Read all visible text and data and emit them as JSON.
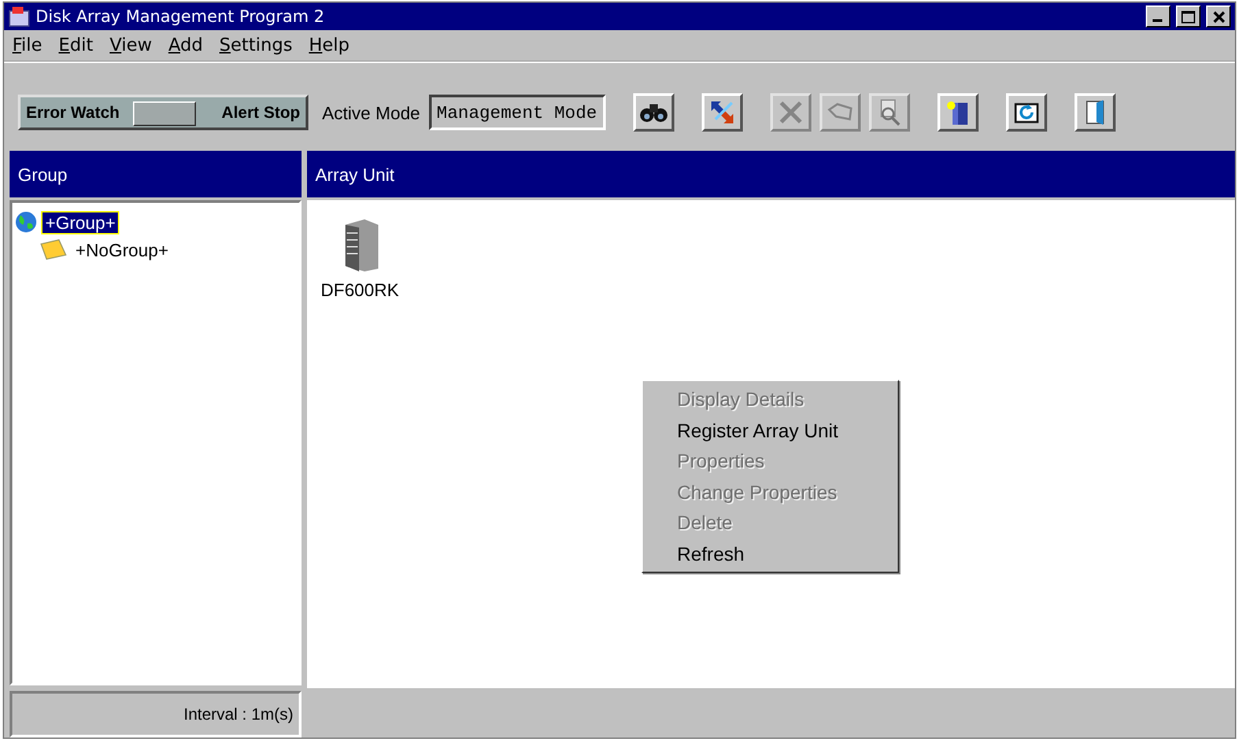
{
  "window": {
    "title": "Disk Array Management Program 2"
  },
  "menu": [
    "File",
    "Edit",
    "View",
    "Add",
    "Settings",
    "Help"
  ],
  "toolbar": {
    "switch_labels": [
      "Error Watch",
      "Alert Stop"
    ],
    "switch": {
      "level": 0.5
    },
    "mode_label": "Active Mode",
    "mode_value": "Management Mode",
    "buttons": [
      {
        "kind": "binoculars",
        "disabled": false
      },
      {
        "kind": "arrows",
        "disabled": false
      },
      {
        "kind": "cross",
        "disabled": true
      },
      {
        "kind": "tag",
        "disabled": true
      },
      {
        "kind": "magnifier",
        "disabled": true
      },
      {
        "kind": "server",
        "disabled": false
      },
      {
        "kind": "refresh",
        "disabled": false
      },
      {
        "kind": "exit",
        "disabled": false
      }
    ]
  },
  "group_panel": {
    "title": "Group",
    "tree": [
      {
        "label": "+Group+",
        "selected": true,
        "children": [
          {
            "label": "+NoGroup+",
            "selected": false
          }
        ]
      }
    ]
  },
  "array_panel": {
    "title": "Array Unit",
    "units": [
      {
        "label": "DF600RK"
      }
    ]
  },
  "context_menu": [
    {
      "label": "Display Details",
      "disabled": true
    },
    {
      "label": "Register Array Unit",
      "disabled": false
    },
    {
      "label": "Properties",
      "disabled": true
    },
    {
      "label": "Change Properties",
      "disabled": true
    },
    {
      "label": "Delete",
      "disabled": true
    },
    {
      "label": "Refresh",
      "disabled": false
    }
  ],
  "status_bar": {
    "interval": "Interval : 1m(s)"
  }
}
